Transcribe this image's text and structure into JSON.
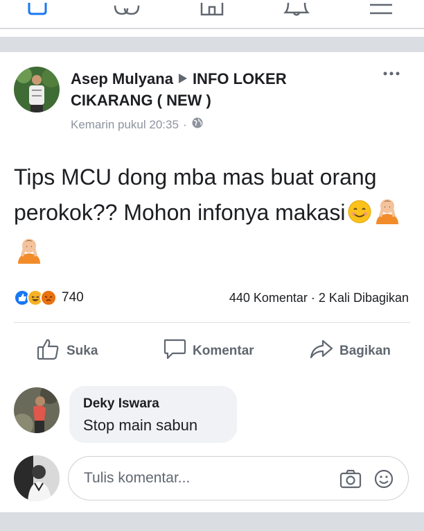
{
  "post": {
    "author": "Asep Mulyana",
    "group": "INFO LOKER CIKARANG ( NEW )",
    "time": "Kemarin pukul 20:35",
    "separator": "·",
    "text": "Tips MCU dong mba mas buat orang perokok?? Mohon infonya makasi",
    "reaction_count": "740",
    "comments_count": "440 Komentar",
    "shares_count": "2 Kali Dibagikan"
  },
  "actions": {
    "like": "Suka",
    "comment": "Komentar",
    "share": "Bagikan"
  },
  "comment": {
    "author": "Deky Iswara",
    "text": "Stop main sabun"
  },
  "composer": {
    "placeholder": "Tulis komentar..."
  },
  "icons": {
    "top_nav": [
      "home-icon",
      "groups-icon",
      "marketplace-icon",
      "notifications-icon",
      "menu-icon"
    ],
    "reactions": [
      "like-reaction-icon",
      "haha-reaction-icon",
      "angry-reaction-icon"
    ],
    "post_text_emoji": [
      "smiling-face-emoji",
      "person-gesturing-ok-emoji",
      "person-gesturing-ok-emoji"
    ]
  },
  "colors": {
    "like_blue": "#1877f2",
    "reaction_yellow": "#f7b125",
    "angry_orange": "#e9710f",
    "muted_text": "#606770",
    "divider": "#dadde1"
  }
}
